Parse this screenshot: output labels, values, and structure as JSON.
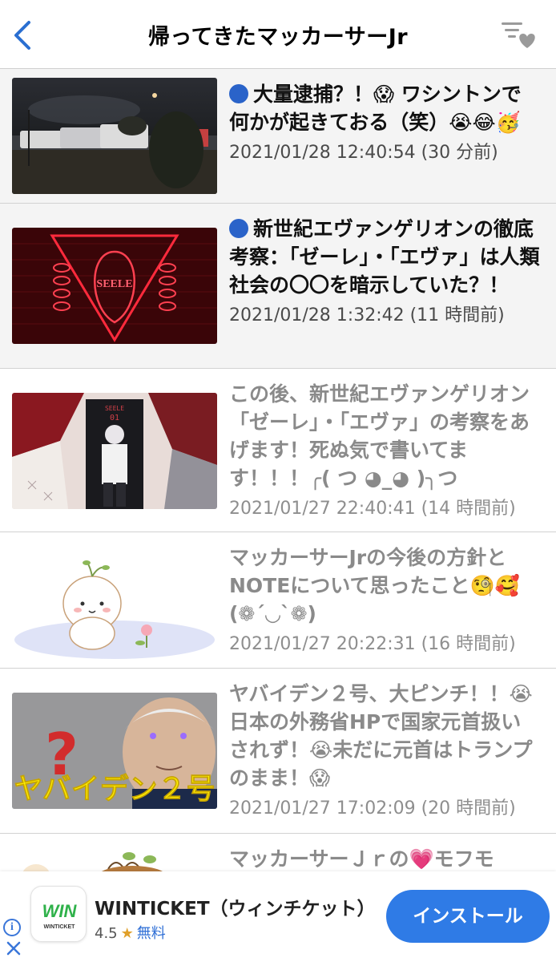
{
  "header": {
    "title": "帰ってきたマッカーサーJr",
    "back_icon": "chevron-left-icon",
    "filter_icon": "favorite-filter-icon",
    "accent_color": "#2a6fd1"
  },
  "articles": [
    {
      "title": "大量逮捕？！😱 ワシントンで何かが起きておる（笑）😭😂🥳",
      "date": "2021/01/28 12:40:54 (30 分前)",
      "unread": true
    },
    {
      "title": "新世紀エヴァンゲリオンの徹底考察：「ゼーレ」・「エヴァ」は人類社会の〇〇を暗示していた？！",
      "date": "2021/01/28 1:32:42 (11 時間前)",
      "unread": true
    },
    {
      "title": "この後、新世紀エヴァンゲリオン「ゼーレ」・「エヴァ」の考察をあげます！死ぬ気で書いてます！！！╭( つ ◕_◕ )╮つ",
      "date": "2021/01/27 22:40:41 (14 時間前)",
      "unread": false
    },
    {
      "title": "マッカーサーJrの今後の方針とNOTEについて思ったこと🧐🥰 (❁´◡`❁)",
      "date": "2021/01/27 20:22:31 (16 時間前)",
      "unread": false
    },
    {
      "title": "ヤバイデン２号、大ピンチ！！😭日本の外務省HPで国家元首扱いされず！😭未だに元首はトランプのまま！😱",
      "date": "2021/01/27 17:02:09 (20 時間前)",
      "unread": false,
      "thumb_caption": "ヤバイデン２号"
    },
    {
      "title": "マッカーサーＪｒの💗モフモ",
      "date": "",
      "unread": false
    }
  ],
  "thumbnail_texts": {
    "seele_logo": "SEELE",
    "seele_card": "SEELE",
    "seele_card_number": "01"
  },
  "ad": {
    "app_name": "WINTICKET（ウィンチケット）",
    "rating": "4.5",
    "price": "無料",
    "install_label": "インストール",
    "icon_text": "WIN",
    "icon_subtext": "WINTICKET",
    "info_icon": "i"
  }
}
